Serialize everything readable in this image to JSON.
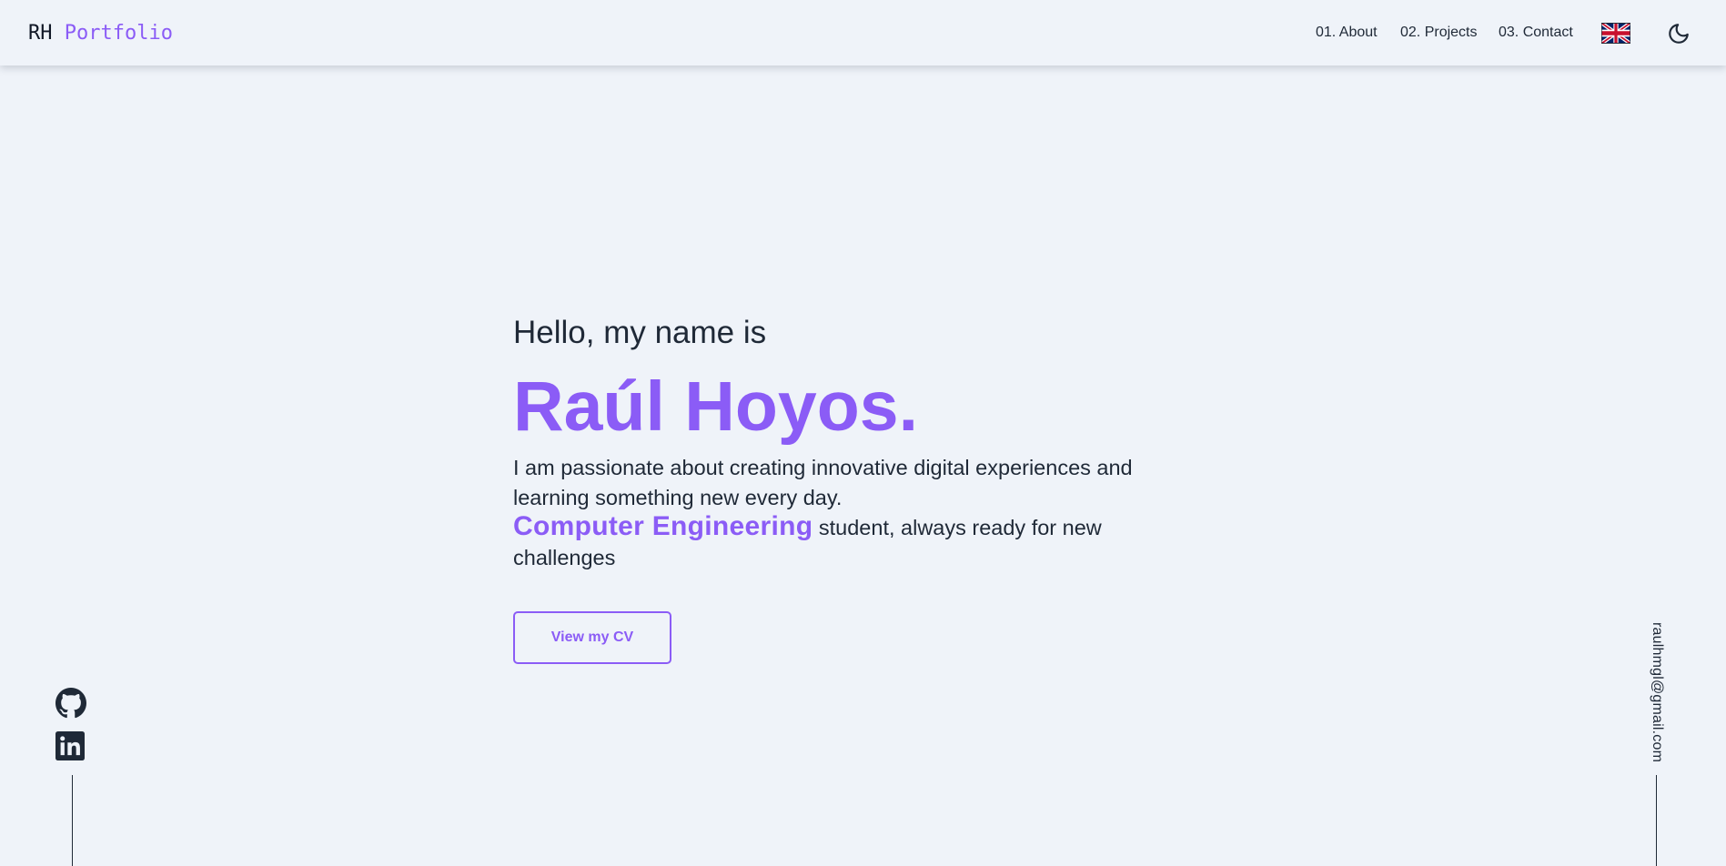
{
  "header": {
    "logo_prefix": "RH",
    "logo_accent": "Portfolio",
    "nav": [
      {
        "label": "01. About"
      },
      {
        "label": "02. Projects"
      },
      {
        "label": "03. Contact"
      }
    ],
    "language_icon": "uk-flag-icon",
    "theme_icon": "moon-icon"
  },
  "hero": {
    "greeting": "Hello, my name is",
    "name": "Raúl Hoyos.",
    "description": "I am passionate about creating innovative digital experiences and learning something new every day.",
    "highlight": "Computer Engineering",
    "description_rest": "student, always ready for new challenges",
    "cv_button": "View my CV"
  },
  "social": {
    "items": [
      {
        "icon": "github-icon"
      },
      {
        "icon": "linkedin-icon"
      }
    ]
  },
  "email": "raulhmgl@gmail.com",
  "colors": {
    "accent": "#8b5cf6",
    "background": "#eff3f9",
    "text": "#1f2937"
  }
}
